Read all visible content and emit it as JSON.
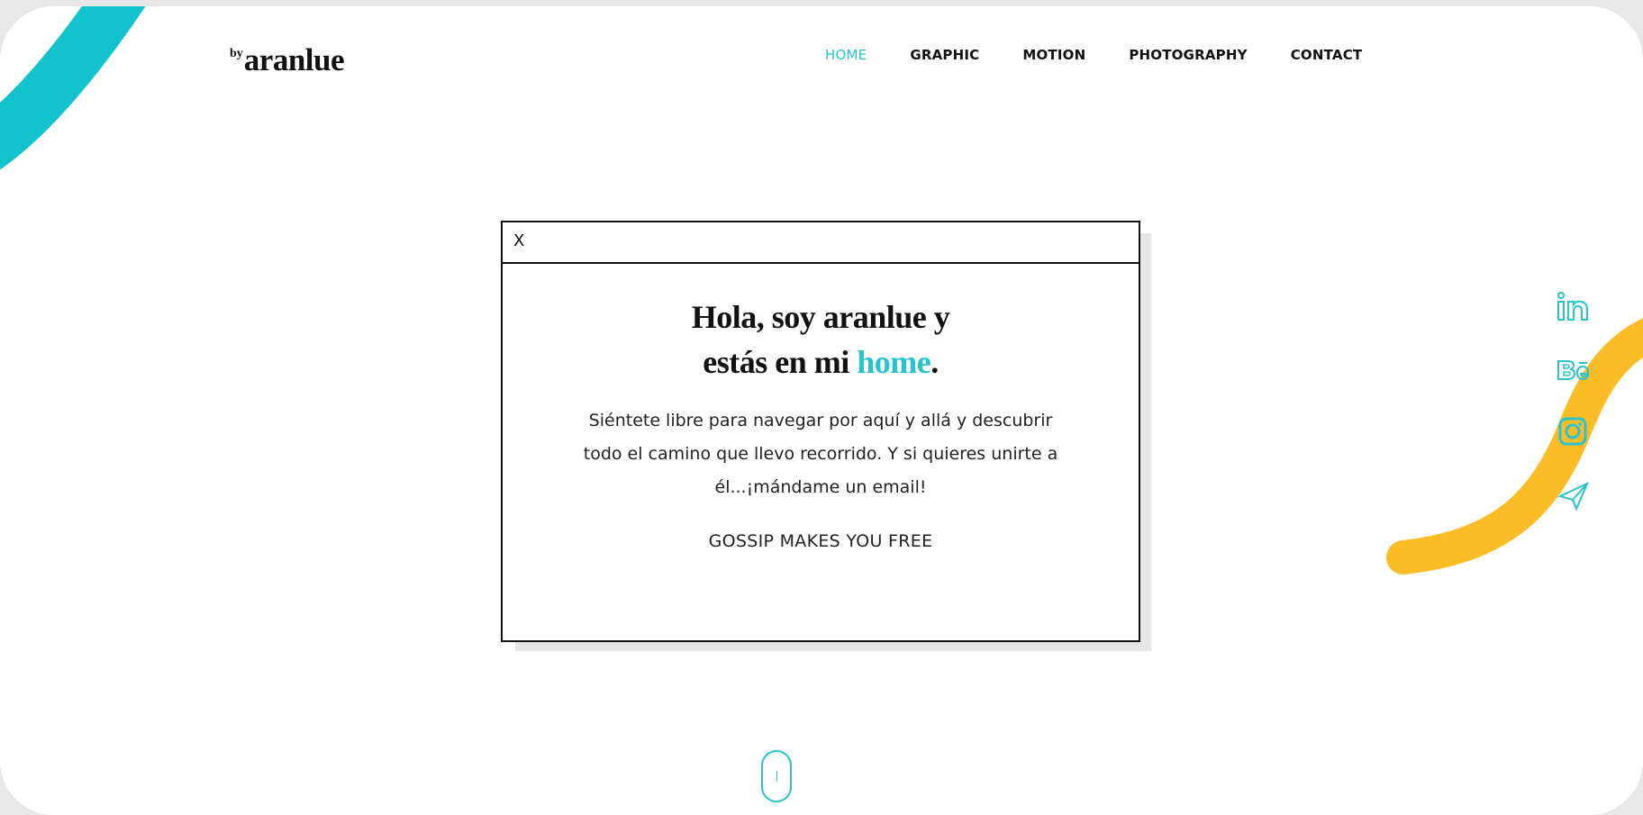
{
  "brand": {
    "prefix": "by",
    "name": "aranlue"
  },
  "nav": {
    "items": [
      {
        "label": "HOME",
        "active": true
      },
      {
        "label": "GRAPHIC",
        "active": false
      },
      {
        "label": "MOTION",
        "active": false
      },
      {
        "label": "PHOTOGRAPHY",
        "active": false
      },
      {
        "label": "CONTACT",
        "active": false
      }
    ]
  },
  "dialog": {
    "close_label": "X",
    "title_line1": "Hola, soy aranlue y",
    "title_line2_pre": "estás en mi ",
    "title_line2_highlight": "home",
    "title_line2_post": ".",
    "text": "Siéntete libre para navegar por aquí y allá y descubrir todo el camino que llevo recorrido. Y si quieres unirte a él...¡mándame un email!",
    "tagline": "GOSSIP MAKES YOU FREE"
  },
  "social": {
    "icons": [
      "linkedin-icon",
      "behance-icon",
      "instagram-icon",
      "send-icon"
    ]
  },
  "colors": {
    "accent": "#27c3cf",
    "yellow": "#fbbc26",
    "text": "#111111"
  }
}
